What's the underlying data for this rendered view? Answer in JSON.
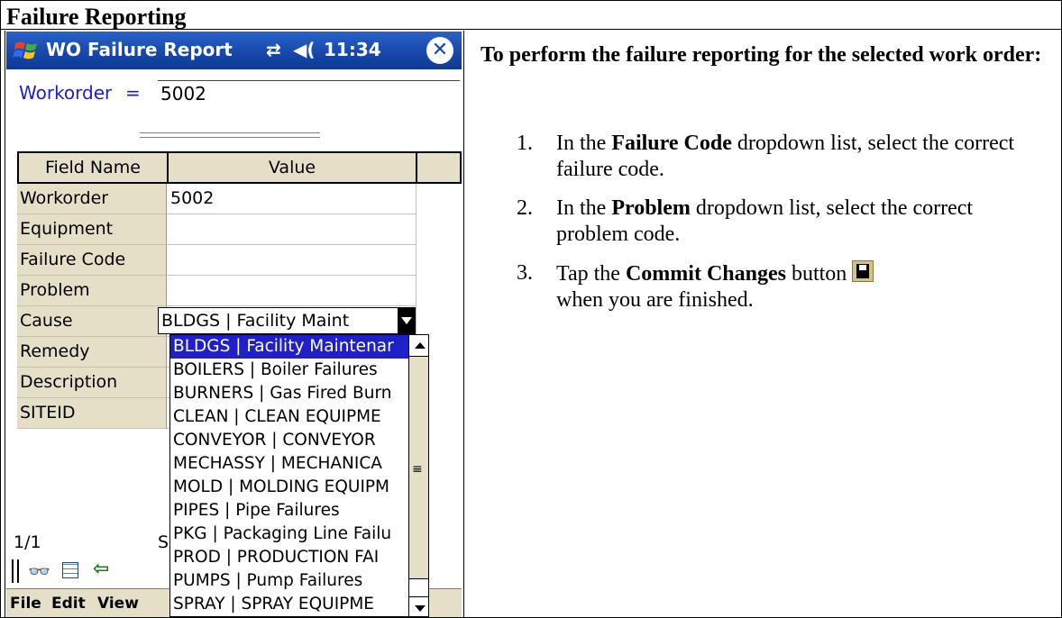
{
  "doc": {
    "header": "Failure Reporting",
    "intro": "To perform the failure reporting for the selected work order:",
    "steps": [
      {
        "num": "1.",
        "pre": "In the ",
        "bold": "Failure Code",
        "post": " dropdown list, select the correct failure code."
      },
      {
        "num": "2.",
        "pre": "In the ",
        "bold": "Problem",
        "post": " dropdown list, select the correct problem code."
      },
      {
        "num": "3.",
        "pre": "Tap the ",
        "bold": "Commit Changes",
        "post": " button",
        "tail": "when you are finished.",
        "icon": "save-icon"
      }
    ]
  },
  "pda": {
    "title": "WO Failure Report",
    "sync_glyph": "⇄",
    "speaker_glyph": "◀(",
    "clock": "11:34",
    "close_glyph": "✕",
    "workorder_label": "Workorder",
    "workorder_eq": "=",
    "workorder_value": "5002",
    "grid": {
      "headers": [
        "Field Name",
        "Value"
      ],
      "rows": [
        {
          "name": "Workorder",
          "value": "5002"
        },
        {
          "name": "Equipment",
          "value": ""
        },
        {
          "name": "Failure Code",
          "value": ""
        },
        {
          "name": "Problem",
          "value": ""
        },
        {
          "name": "Cause",
          "value": ""
        },
        {
          "name": "Remedy",
          "value": ""
        },
        {
          "name": "Description",
          "value": ""
        },
        {
          "name": "SITEID",
          "value": ""
        }
      ]
    },
    "combo_value": "BLDGS | Facility Maint",
    "dropdown": [
      "BLDGS | Facility Maintenar",
      "BOILERS | Boiler Failures",
      "BURNERS | Gas Fired Burn",
      "CLEAN |  CLEAN EQUIPME",
      "CONVEYOR | CONVEYOR",
      "MECHASSY | MECHANICA",
      "MOLD | MOLDING EQUIPM",
      "PIPES | Pipe Failures",
      "PKG | Packaging Line Failu",
      "PROD | PRODUCTION FAI",
      "PUMPS | Pump Failures",
      "SPRAY | SPRAY EQUIPME"
    ],
    "dropdown_selected_index": 0,
    "page_count": "1/1",
    "bottom_s": "S",
    "scroll_grip": "≡",
    "toolbar": {
      "glasses_glyph": "👓",
      "back_glyph": "⇦"
    },
    "menu": [
      "File",
      "Edit",
      "View"
    ]
  }
}
